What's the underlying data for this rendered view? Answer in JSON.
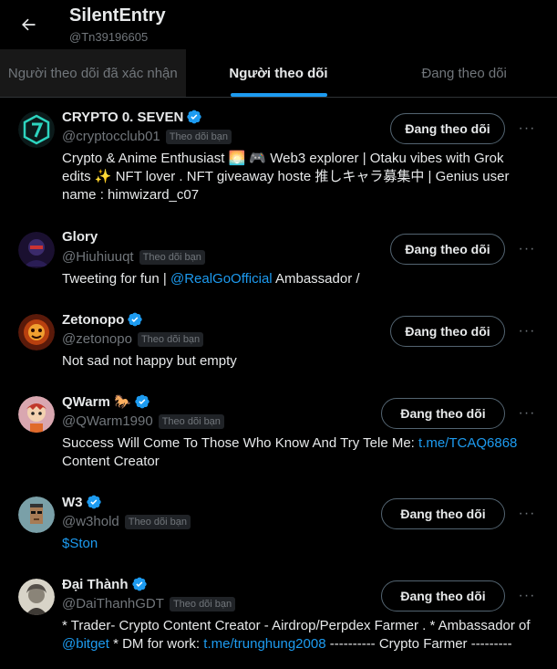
{
  "header": {
    "title": "SilentEntry",
    "handle": "@Tn39196605"
  },
  "tabs": [
    {
      "label": "Người theo dõi đã xác nhận",
      "active": false
    },
    {
      "label": "Người theo dõi",
      "active": true
    },
    {
      "label": "Đang theo dõi",
      "active": false
    }
  ],
  "follows_you_label": "Theo dõi bạn",
  "follow_button_label": "Đang theo dõi",
  "more_label": "···",
  "colors": {
    "accent": "#1d9bf0",
    "background": "#000000",
    "muted": "#71767b",
    "verified": "#1d9bf0"
  },
  "users": [
    {
      "name": "CRYPTO 0. SEVEN",
      "handle": "@cryptocclub01",
      "verified": true,
      "avatar_icon": "crypto-seven-logo",
      "bio_parts": [
        {
          "text": "Crypto & Anime Enthusiast 🌅 🎮 Web3 explorer | Otaku vibes with Grok edits ✨ NFT lover . NFT giveaway hoste 推しキャラ募集中 | Genius user name : himwizard_c07",
          "link": false
        }
      ]
    },
    {
      "name": "Glory",
      "handle": "@Hiuhiuuqt",
      "verified": false,
      "avatar_icon": "masked-figure-avatar",
      "bio_parts": [
        {
          "text": "Tweeting for fun | ",
          "link": false
        },
        {
          "text": "@RealGoOfficial",
          "link": true
        },
        {
          "text": " Ambassador /",
          "link": false
        }
      ]
    },
    {
      "name": "Zetonopo",
      "handle": "@zetonopo",
      "verified": true,
      "avatar_icon": "fiery-face-avatar",
      "bio_parts": [
        {
          "text": "Not sad not happy but empty",
          "link": false
        }
      ]
    },
    {
      "name": "QWarm 🐎",
      "handle": "@QWarm1990",
      "verified": true,
      "avatar_icon": "cartoon-character-avatar",
      "bio_parts": [
        {
          "text": "Success Will Come To Those Who Know And Try Tele Me: ",
          "link": false
        },
        {
          "text": "t.me/TCAQ6868",
          "link": true
        },
        {
          "text": " Content Creator",
          "link": false
        }
      ]
    },
    {
      "name": "W3",
      "handle": "@w3hold",
      "verified": true,
      "avatar_icon": "pixel-punk-avatar",
      "bio_parts": [
        {
          "text": "$Ston",
          "link": true
        }
      ]
    },
    {
      "name": "Đại Thành",
      "handle": "@DaiThanhGDT",
      "verified": true,
      "avatar_icon": "franklin-portrait-avatar",
      "bio_parts": [
        {
          "text": "* Trader- Crypto Content Creator - Airdrop/Perpdex Farmer . * Ambassador of ",
          "link": false
        },
        {
          "text": "@bitget",
          "link": true
        },
        {
          "text": " * DM for work: ",
          "link": false
        },
        {
          "text": "t.me/trunghung2008",
          "link": true
        },
        {
          "text": " ---------- Crypto Farmer ---------",
          "link": false
        }
      ]
    }
  ]
}
